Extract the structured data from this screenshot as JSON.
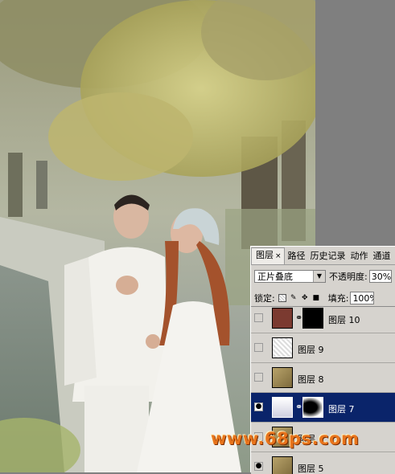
{
  "panel": {
    "tabs": [
      {
        "label": "图层",
        "active": true
      },
      {
        "label": "路径",
        "active": false
      },
      {
        "label": "历史记录",
        "active": false
      },
      {
        "label": "动作",
        "active": false
      },
      {
        "label": "通道",
        "active": false
      }
    ],
    "close_glyph": "×",
    "blend_mode": "正片叠底",
    "opacity_label": "不透明度:",
    "opacity_value": "30%",
    "lock_label": "锁定:",
    "fill_label": "填充:",
    "fill_value": "100%",
    "layers": [
      {
        "name": "图层 10",
        "visible": false,
        "has_mask": true,
        "selected": false
      },
      {
        "name": "图层 9",
        "visible": false,
        "has_mask": false,
        "selected": false
      },
      {
        "name": "图层 8",
        "visible": false,
        "has_mask": false,
        "selected": false
      },
      {
        "name": "图层 7",
        "visible": true,
        "has_mask": true,
        "selected": true
      },
      {
        "name": "图层 6",
        "visible": false,
        "has_mask": false,
        "selected": false
      },
      {
        "name": "图层 5",
        "visible": true,
        "has_mask": false,
        "selected": false
      }
    ]
  },
  "icons": {
    "eye": "eye-icon",
    "chain": "link-icon",
    "lock_transparent": "lock-transparent-pixels-icon",
    "lock_brush": "brush-icon",
    "lock_move": "move-icon",
    "lock_all": "lock-icon",
    "dropdown": "chevron-down-icon"
  },
  "watermark": "www.68ps.com",
  "colors": {
    "selection": "#0a246a",
    "panel_bg": "#d6d3ce",
    "watermark": "#e8741c",
    "layer10_thumb": "#7b3a30"
  }
}
